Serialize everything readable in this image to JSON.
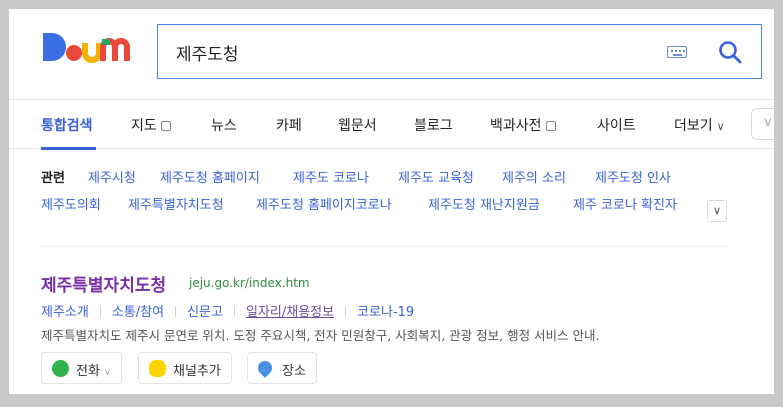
{
  "brand": {
    "logo_text": "Daum",
    "colors": {
      "blue": "#3b6ee5",
      "red": "#e8493a",
      "yellow": "#f3b300",
      "green": "#29a45f"
    }
  },
  "search": {
    "query": "제주도청",
    "keyboard_icon": "keyboard-icon",
    "submit_icon": "search-icon"
  },
  "nav": {
    "items": [
      {
        "label": "통합검색",
        "active": true
      },
      {
        "label": "지도",
        "has_checkbox": true
      },
      {
        "label": "뉴스"
      },
      {
        "label": "카페"
      },
      {
        "label": "웹문서"
      },
      {
        "label": "블로그"
      },
      {
        "label": "백과사전",
        "has_checkbox": true
      },
      {
        "label": "사이트"
      },
      {
        "label": "더보기",
        "dropdown": true
      }
    ],
    "edge_text": "v"
  },
  "related": {
    "label": "관련",
    "row1": [
      "제주시청",
      "제주도청 홈페이지",
      "제주도 코로나",
      "제주도 교육청",
      "제주의 소리",
      "제주도청 인사"
    ],
    "row2": [
      "제주도의회",
      "제주특별자치도청",
      "제주도청 홈페이지코로나",
      "제주도청 재난지원금",
      "제주 코로나 확진자"
    ],
    "more_icon": "chevron-down-icon"
  },
  "result": {
    "title": "제주특별자치도청",
    "url": "jeju.go.kr/index.htm",
    "sublinks": [
      {
        "label": "제주소개"
      },
      {
        "label": "소통/참여"
      },
      {
        "label": "신문고"
      },
      {
        "label": "일자리/채용정보",
        "visited": true
      },
      {
        "label": "코로나-19"
      }
    ],
    "description": "제주특별자치도 제주시 문연로 위치. 도정 주요시책, 전자 민원창구, 사회복지, 관광 정보, 행정 서비스 안내.",
    "actions": [
      {
        "label": "전화",
        "icon": "phone-icon",
        "dropdown": true
      },
      {
        "label": "채널추가",
        "icon": "chat-icon"
      },
      {
        "label": "장소",
        "icon": "map-pin-icon"
      }
    ]
  }
}
